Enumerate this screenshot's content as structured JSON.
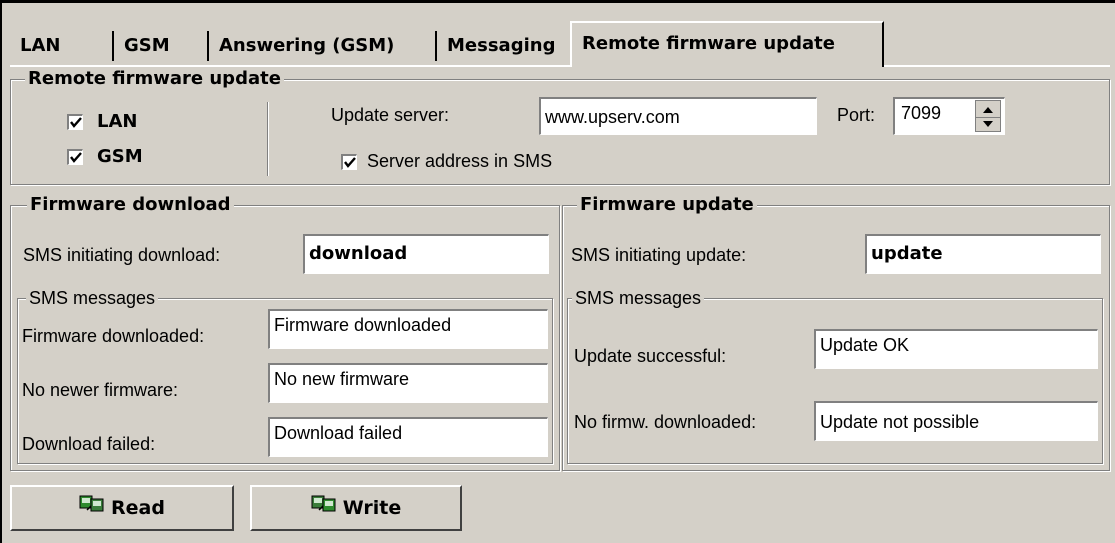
{
  "tabs": [
    "LAN",
    "GSM",
    "Answering (GSM)",
    "Messaging",
    "Remote firmware update"
  ],
  "active_tab": "Remote firmware update",
  "remote": {
    "title": "Remote firmware update",
    "lan_label": "LAN",
    "lan_checked": true,
    "gsm_label": "GSM",
    "gsm_checked": true,
    "server_label": "Update server:",
    "server_value": "www.upserv.com",
    "port_label": "Port:",
    "port_value": "7099",
    "sms_address_label": "Server address in SMS",
    "sms_address_checked": true
  },
  "download": {
    "title": "Firmware download",
    "initiating_label": "SMS initiating download:",
    "initiating_value": "download",
    "sms_title": "SMS messages",
    "downloaded_label": "Firmware downloaded:",
    "downloaded_value": "Firmware downloaded",
    "no_newer_label": "No newer firmware:",
    "no_newer_value": "No new firmware",
    "failed_label": "Download failed:",
    "failed_value": "Download failed"
  },
  "update": {
    "title": "Firmware update",
    "initiating_label": "SMS initiating update:",
    "initiating_value": "update",
    "sms_title": "SMS messages",
    "successful_label": "Update successful:",
    "successful_value": "Update OK",
    "not_downloaded_label": "No firmw. downloaded:",
    "not_downloaded_value": "Update not possible"
  },
  "buttons": {
    "read": "Read",
    "write": "Write"
  },
  "icons": {
    "read": "read-device-icon",
    "write": "write-device-icon"
  },
  "colors": {
    "dialog_bg": "#d4d0c8",
    "field_bg": "#ffffff",
    "icon_green": "#2e8b2e"
  }
}
